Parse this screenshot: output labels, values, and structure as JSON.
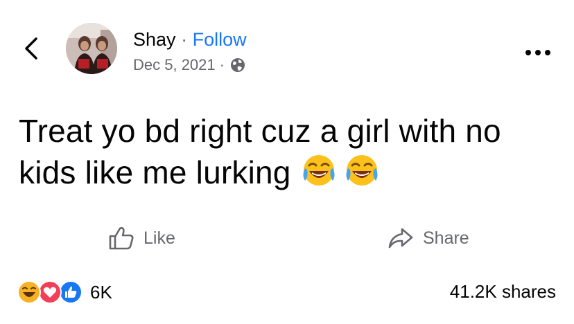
{
  "header": {
    "author_name": "Shay",
    "separator": "·",
    "follow_label": "Follow",
    "date": "Dec 5, 2021",
    "meta_separator": "·",
    "privacy_icon": "globe-icon",
    "back_icon": "chevron-left-icon",
    "more_icon": "more-horizontal-icon"
  },
  "post": {
    "text": "Treat yo bd right cuz a girl with no kids like me lurking",
    "emojis": [
      "face-with-tears-of-joy-icon",
      "face-with-tears-of-joy-icon"
    ]
  },
  "actions": {
    "like_label": "Like",
    "share_label": "Share"
  },
  "footer": {
    "reaction_icons": [
      "haha-reaction-icon",
      "love-reaction-icon",
      "like-reaction-icon"
    ],
    "reaction_count": "6K",
    "shares": "41.2K shares"
  },
  "colors": {
    "accent": "#1877f2",
    "secondary_text": "#65676b",
    "love": "#f33e58",
    "haha": "#f7b125"
  }
}
